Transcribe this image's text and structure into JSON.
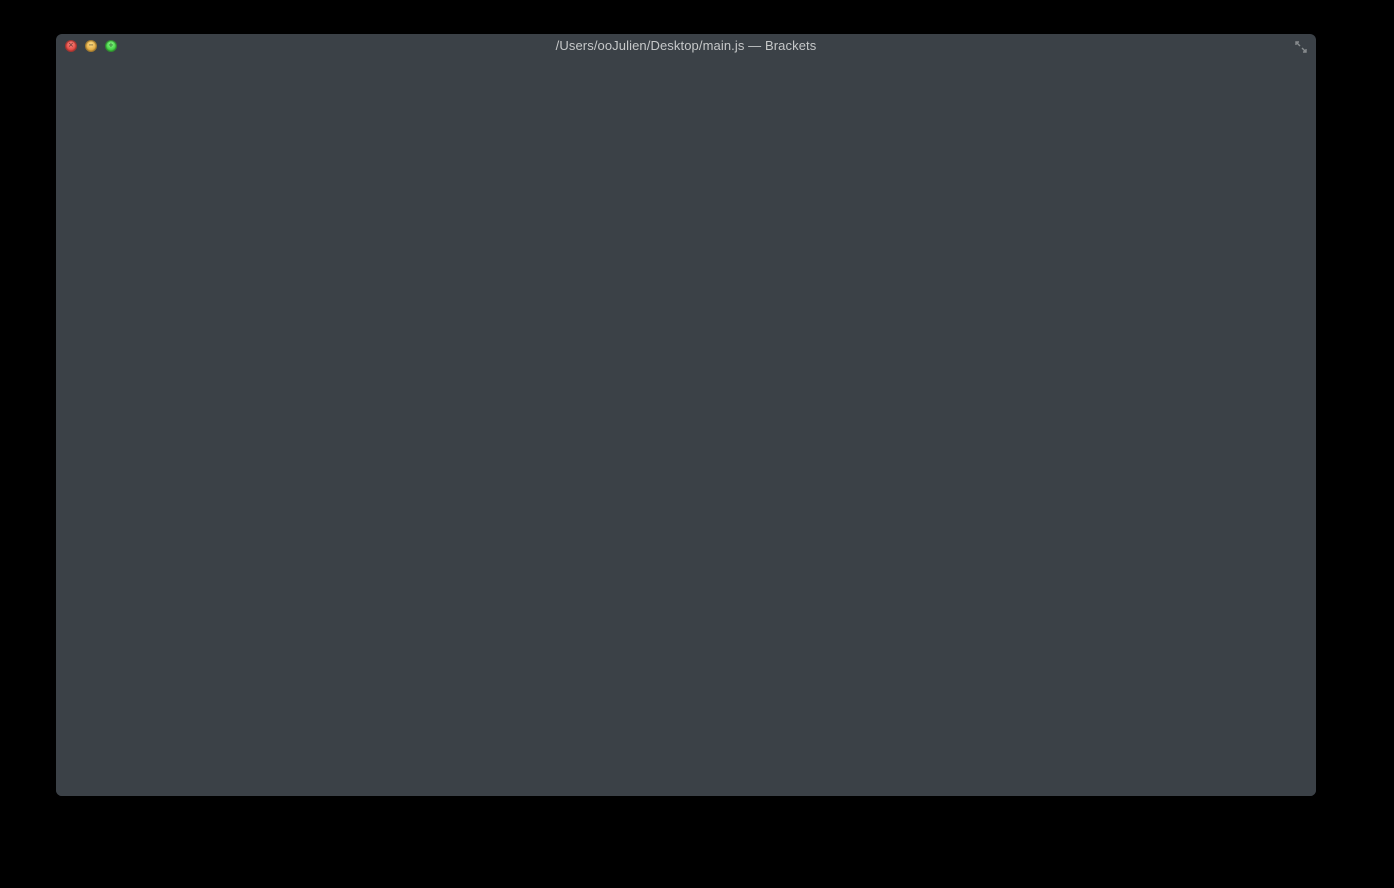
{
  "window": {
    "title": "/Users/ooJulien/Desktop/main.js — Brackets"
  },
  "traffic_lights": {
    "close": "close",
    "minimize": "minimize",
    "zoom": "zoom"
  },
  "icons": {
    "fullscreen": "fullscreen-icon"
  }
}
